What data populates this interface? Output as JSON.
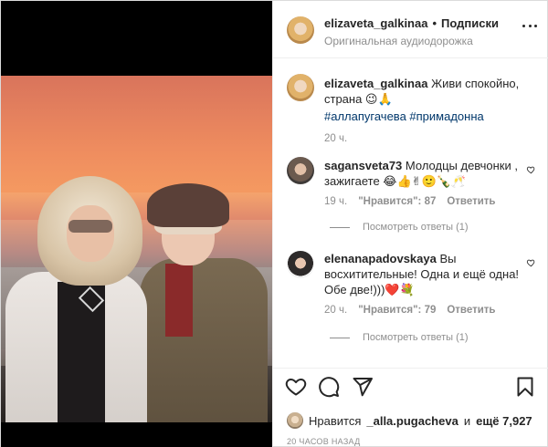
{
  "header": {
    "username": "elizaveta_galkinaa",
    "separator": "•",
    "follow_label": "Подписки",
    "audio_label": "Оригинальная аудиодорожка"
  },
  "caption": {
    "username": "elizaveta_galkinaa",
    "text": "Живи спокойно, страна 😉🙏",
    "hashtags": "#аллапугачева #примадонна",
    "time": "20 ч."
  },
  "comments": [
    {
      "username": "sagansveta73",
      "text": "Молодцы девчонки , зажигаете 😂👍✌🙂🍾🥂",
      "time": "19 ч.",
      "likes": "\"Нравится\": 87",
      "reply": "Ответить",
      "view_replies": "Посмотреть ответы (1)"
    },
    {
      "username": "elenanapadovskaya",
      "text": "Вы восхитительные! Одна и ещё одна! Обе две!)))❤️💐",
      "time": "20 ч.",
      "likes": "\"Нравится\": 79",
      "reply": "Ответить",
      "view_replies": "Посмотреть ответы (1)"
    }
  ],
  "likes_line": {
    "prefix": "Нравится",
    "user": "_alla.pugacheva",
    "middle": "и",
    "suffix": "ещё 7,927"
  },
  "timestamp": "20 ЧАСОВ НАЗАД",
  "icons": {
    "like": "heart-icon",
    "comment": "comment-icon",
    "share": "send-icon",
    "save": "bookmark-icon",
    "more": "more-icon"
  }
}
